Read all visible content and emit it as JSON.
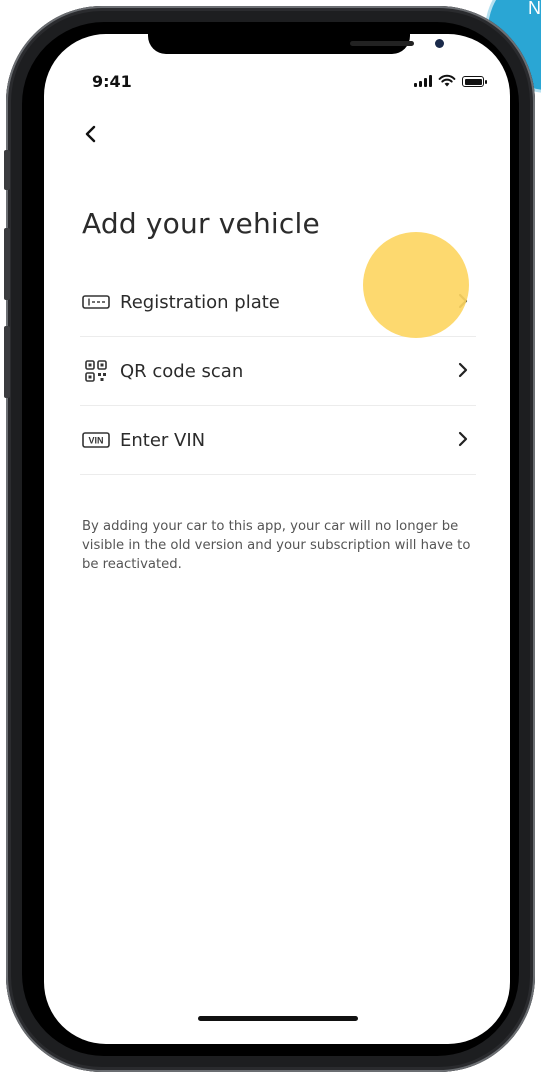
{
  "status_bar": {
    "time": "9:41"
  },
  "header": {
    "title": "Add your vehicle"
  },
  "options": [
    {
      "label": "Registration plate",
      "icon": "license-plate-icon"
    },
    {
      "label": "QR code scan",
      "icon": "qr-code-icon"
    },
    {
      "label": "Enter VIN",
      "icon": "vin-icon",
      "icon_text": "VIN"
    }
  ],
  "disclaimer": "By adding your car to this app, your car will no longer be visible in the old version and your subscription will have to be reactivated.",
  "overlay": {
    "corner_text": "N"
  },
  "colors": {
    "tap_highlight": "#FDD663",
    "corner_bubble": "#2AA6D4",
    "text_primary": "#2B2B2B",
    "text_secondary": "#555555"
  }
}
